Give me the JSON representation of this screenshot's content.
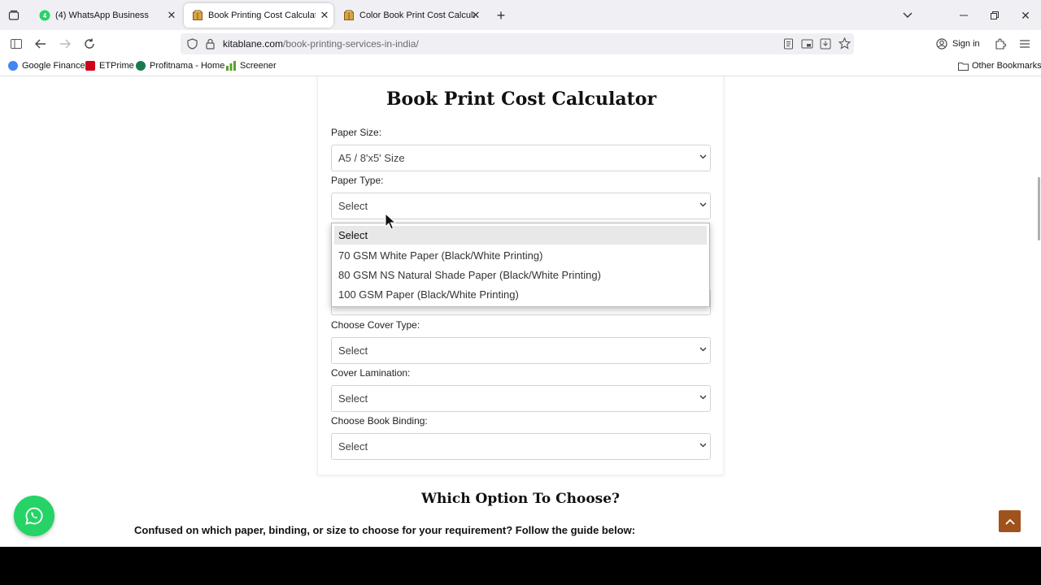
{
  "tabs": [
    {
      "label": "(4) WhatsApp Business",
      "active": false,
      "icon": "whatsapp-icon"
    },
    {
      "label": "Book Printing Cost Calculator",
      "active": true,
      "icon": "package-icon"
    },
    {
      "label": "Color Book Print Cost Calculator",
      "active": false,
      "icon": "package-icon"
    }
  ],
  "url": {
    "domain": "kitablane.com",
    "path": "/book-printing-services-in-india/"
  },
  "nav": {
    "signin_label": "Sign in"
  },
  "bookmarks": [
    {
      "label": "Google Finance",
      "color": "#4285f4"
    },
    {
      "label": "ETPrime",
      "color": "#d0021b"
    },
    {
      "label": "Profitnama - Home",
      "color": "#1a7a4c"
    },
    {
      "label": "Screener",
      "color": "#5aa02c"
    }
  ],
  "other_bookmarks": "Other Bookmarks",
  "calculator": {
    "title": "Book Print Cost Calculator",
    "fields": [
      {
        "label": "Paper Size:",
        "value": "A5 / 8'x5' Size"
      },
      {
        "label": "Paper Type:",
        "value": "Select"
      },
      {
        "label": "Choose Cover Type:",
        "value": "Select"
      },
      {
        "label": "Cover Lamination:",
        "value": "Select"
      },
      {
        "label": "Choose Book Binding:",
        "value": "Select"
      }
    ],
    "dropdown_options": [
      "Select",
      "70 GSM White Paper (Black/White Printing)",
      "80 GSM NS Natural Shade Paper (Black/White Printing)",
      "100 GSM Paper (Black/White Printing)"
    ],
    "highlighted_option": 0
  },
  "section": {
    "heading": "Which Option To Choose?",
    "intro": "Confused on which paper, binding, or size to choose for your requirement? Follow the guide below:"
  },
  "colors": {
    "whatsapp": "#25d366",
    "scroll_top": "#a0521d",
    "tab_bg": "#f0f0f4"
  }
}
